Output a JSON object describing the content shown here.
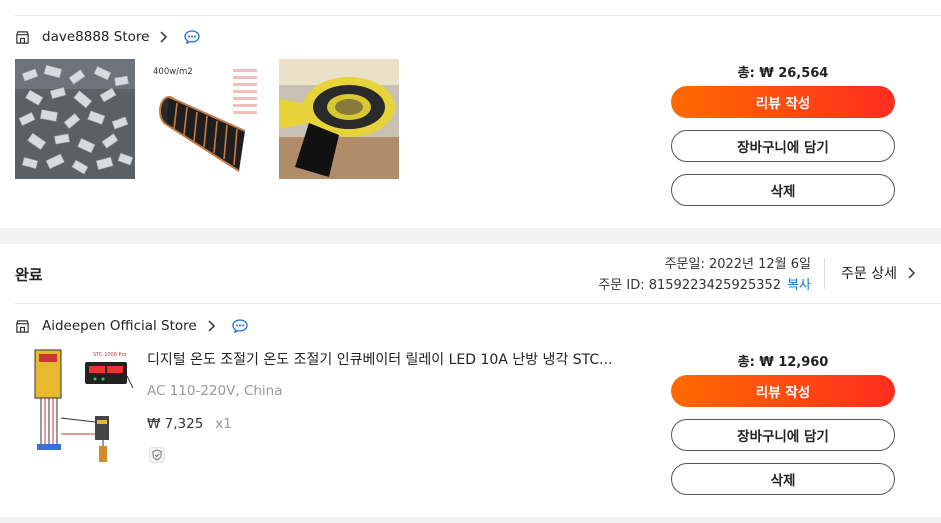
{
  "order1": {
    "store_name": "dave8888 Store",
    "images": [
      {
        "name": "silver-parts-photo"
      },
      {
        "name": "heating-film-photo",
        "caption": "400w/m2"
      },
      {
        "name": "yellow-tape-photo"
      }
    ],
    "total": "총: ₩ 26,564",
    "buttons": {
      "review": "리뷰 작성",
      "cart": "장바구니에 담기",
      "delete": "삭제"
    }
  },
  "order2": {
    "status": "완료",
    "order_date": "주문일: 2022년 12월 6일",
    "order_id": "주문 ID: 8159223425925352",
    "copy_label": "복사",
    "detail_label": "주문 상세",
    "store_name": "Aideepen Official Store",
    "product": {
      "title": "디지털 온도 조절기 온도 조절기 인큐베이터 릴레이 LED 10A 난방 냉각 STC...",
      "sku": "AC 110-220V, China",
      "price": "₩ 7,325",
      "qty": "x1",
      "image_label": "STC-1000 Pro"
    },
    "total": "총: ₩ 12,960",
    "buttons": {
      "review": "리뷰 작성",
      "cart": "장바구니에 담기",
      "delete": "삭제"
    }
  },
  "colors": {
    "accent_start": "#ff6a00",
    "accent_end": "#ff2d20",
    "link": "#1a6fd6"
  }
}
